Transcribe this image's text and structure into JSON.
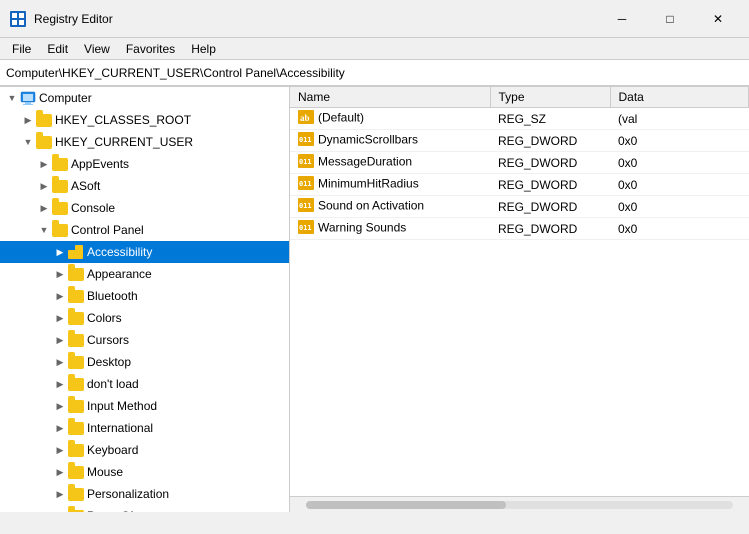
{
  "window": {
    "title": "Registry Editor",
    "address": "Computer\\HKEY_CURRENT_USER\\Control Panel\\Accessibility"
  },
  "menu": {
    "items": [
      "File",
      "Edit",
      "View",
      "Favorites",
      "Help"
    ]
  },
  "tree": {
    "items": [
      {
        "id": "computer",
        "label": "Computer",
        "indent": 0,
        "expand": "expanded",
        "type": "computer"
      },
      {
        "id": "hkey_classes",
        "label": "HKEY_CLASSES_ROOT",
        "indent": 1,
        "expand": "collapsed",
        "type": "folder"
      },
      {
        "id": "hkey_current",
        "label": "HKEY_CURRENT_USER",
        "indent": 1,
        "expand": "expanded",
        "type": "folder"
      },
      {
        "id": "appevents",
        "label": "AppEvents",
        "indent": 2,
        "expand": "collapsed",
        "type": "folder"
      },
      {
        "id": "asoft",
        "label": "ASoft",
        "indent": 2,
        "expand": "collapsed",
        "type": "folder"
      },
      {
        "id": "console",
        "label": "Console",
        "indent": 2,
        "expand": "collapsed",
        "type": "folder"
      },
      {
        "id": "control_panel",
        "label": "Control Panel",
        "indent": 2,
        "expand": "expanded",
        "type": "folder"
      },
      {
        "id": "accessibility",
        "label": "Accessibility",
        "indent": 3,
        "expand": "collapsed",
        "type": "folder",
        "selected": true
      },
      {
        "id": "appearance",
        "label": "Appearance",
        "indent": 3,
        "expand": "collapsed",
        "type": "folder"
      },
      {
        "id": "bluetooth",
        "label": "Bluetooth",
        "indent": 3,
        "expand": "collapsed",
        "type": "folder"
      },
      {
        "id": "colors",
        "label": "Colors",
        "indent": 3,
        "expand": "collapsed",
        "type": "folder"
      },
      {
        "id": "cursors",
        "label": "Cursors",
        "indent": 3,
        "expand": "collapsed",
        "type": "folder"
      },
      {
        "id": "desktop",
        "label": "Desktop",
        "indent": 3,
        "expand": "collapsed",
        "type": "folder"
      },
      {
        "id": "dontload",
        "label": "don't load",
        "indent": 3,
        "expand": "collapsed",
        "type": "folder"
      },
      {
        "id": "inputmethod",
        "label": "Input Method",
        "indent": 3,
        "expand": "collapsed",
        "type": "folder"
      },
      {
        "id": "international",
        "label": "International",
        "indent": 3,
        "expand": "collapsed",
        "type": "folder"
      },
      {
        "id": "keyboard",
        "label": "Keyboard",
        "indent": 3,
        "expand": "collapsed",
        "type": "folder"
      },
      {
        "id": "mouse",
        "label": "Mouse",
        "indent": 3,
        "expand": "collapsed",
        "type": "folder"
      },
      {
        "id": "personalization",
        "label": "Personalization",
        "indent": 3,
        "expand": "collapsed",
        "type": "folder"
      },
      {
        "id": "powercfg",
        "label": "PowerCfg",
        "indent": 3,
        "expand": "collapsed",
        "type": "folder"
      }
    ]
  },
  "registry_table": {
    "columns": [
      "Name",
      "Type",
      "Data"
    ],
    "rows": [
      {
        "name": "(Default)",
        "type": "REG_SZ",
        "data": "(val",
        "icon": "default"
      },
      {
        "name": "DynamicScrollbars",
        "type": "REG_DWORD",
        "data": "0x0",
        "icon": "dword"
      },
      {
        "name": "MessageDuration",
        "type": "REG_DWORD",
        "data": "0x0",
        "icon": "dword"
      },
      {
        "name": "MinimumHitRadius",
        "type": "REG_DWORD",
        "data": "0x0",
        "icon": "dword"
      },
      {
        "name": "Sound on Activation",
        "type": "REG_DWORD",
        "data": "0x0",
        "icon": "dword"
      },
      {
        "name": "Warning Sounds",
        "type": "REG_DWORD",
        "data": "0x0",
        "icon": "dword"
      }
    ]
  },
  "controls": {
    "minimize": "─",
    "maximize": "□",
    "close": "✕"
  }
}
